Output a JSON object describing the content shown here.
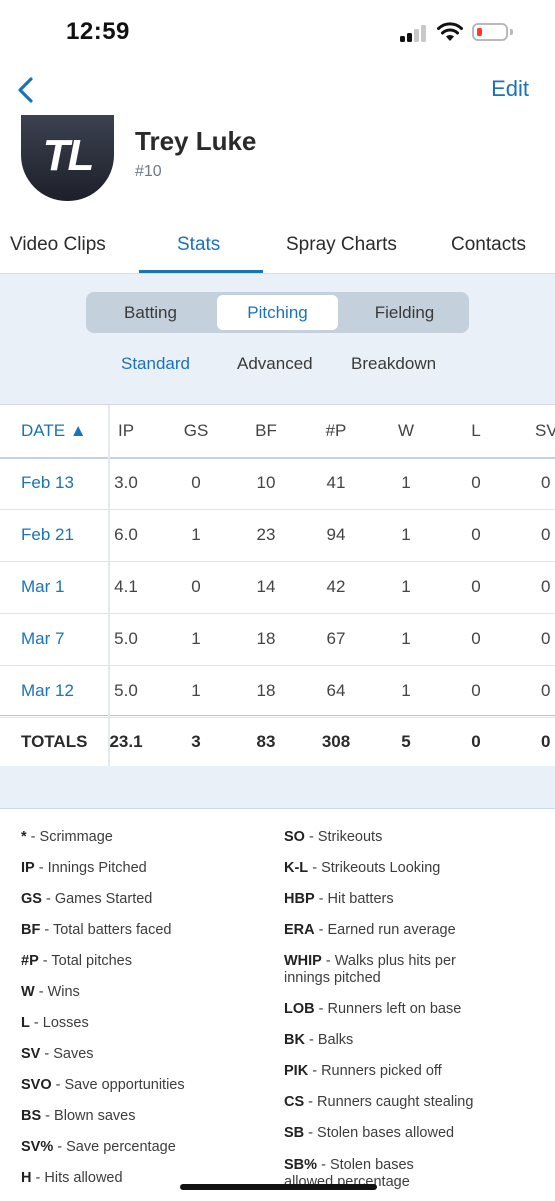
{
  "status_bar": {
    "time": "12:59"
  },
  "header": {
    "edit_label": "Edit",
    "avatar_initials": "TL",
    "player_name": "Trey Luke",
    "player_number": "#10"
  },
  "tabs": [
    "Video Clips",
    "Stats",
    "Spray Charts",
    "Contacts"
  ],
  "segments": [
    "Batting",
    "Pitching",
    "Fielding"
  ],
  "subtabs": [
    "Standard",
    "Advanced",
    "Breakdown"
  ],
  "table": {
    "columns": [
      "DATE ▲",
      "IP",
      "GS",
      "BF",
      "#P",
      "W",
      "L",
      "SV"
    ],
    "rows": [
      [
        "Feb 13",
        "3.0",
        "0",
        "10",
        "41",
        "1",
        "0",
        "0"
      ],
      [
        "Feb 21",
        "6.0",
        "1",
        "23",
        "94",
        "1",
        "0",
        "0"
      ],
      [
        "Mar 1",
        "4.1",
        "0",
        "14",
        "42",
        "1",
        "0",
        "0"
      ],
      [
        "Mar 7",
        "5.0",
        "1",
        "18",
        "67",
        "1",
        "0",
        "0"
      ],
      [
        "Mar 12",
        "5.0",
        "1",
        "18",
        "64",
        "1",
        "0",
        "0"
      ]
    ],
    "totals": [
      "TOTALS",
      "23.1",
      "3",
      "83",
      "308",
      "5",
      "0",
      "0"
    ]
  },
  "legend": {
    "left": [
      {
        "abbr": "*",
        "desc": "Scrimmage"
      },
      {
        "abbr": "IP",
        "desc": "Innings Pitched"
      },
      {
        "abbr": "GS",
        "desc": "Games Started"
      },
      {
        "abbr": "BF",
        "desc": "Total batters faced"
      },
      {
        "abbr": "#P",
        "desc": "Total pitches"
      },
      {
        "abbr": "W",
        "desc": "Wins"
      },
      {
        "abbr": "L",
        "desc": "Losses"
      },
      {
        "abbr": "SV",
        "desc": "Saves"
      },
      {
        "abbr": "SVO",
        "desc": "Save opportunities"
      },
      {
        "abbr": "BS",
        "desc": "Blown saves"
      },
      {
        "abbr": "SV%",
        "desc": "Save percentage"
      },
      {
        "abbr": "H",
        "desc": "Hits allowed"
      }
    ],
    "right": [
      {
        "abbr": "SO",
        "desc": "Strikeouts"
      },
      {
        "abbr": "K-L",
        "desc": "Strikeouts Looking"
      },
      {
        "abbr": "HBP",
        "desc": "Hit batters"
      },
      {
        "abbr": "ERA",
        "desc": "Earned run average"
      },
      {
        "abbr": "WHIP",
        "desc": "Walks plus hits per",
        "desc2": "innings pitched"
      },
      {
        "abbr": "LOB",
        "desc": "Runners left on base"
      },
      {
        "abbr": "BK",
        "desc": "Balks"
      },
      {
        "abbr": "PIK",
        "desc": "Runners picked off"
      },
      {
        "abbr": "CS",
        "desc": "Runners caught stealing"
      },
      {
        "abbr": "SB",
        "desc": "Stolen bases allowed"
      },
      {
        "abbr": "SB%",
        "desc": "Stolen bases",
        "desc2": "allowed percentage"
      }
    ]
  },
  "colors": {
    "accent": "#1a73b8",
    "panel": "#eaf0f7",
    "battery_low": "#ff3b30"
  }
}
